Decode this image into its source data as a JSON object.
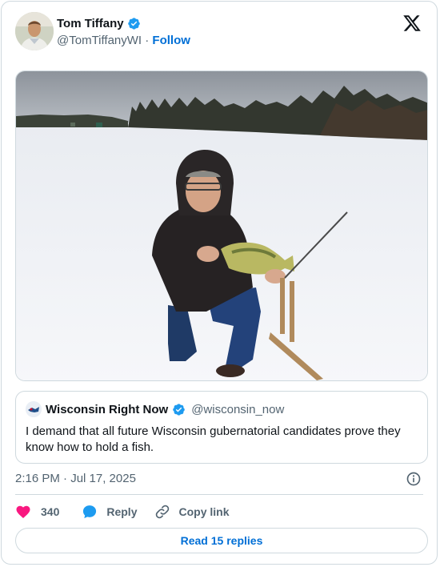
{
  "author": {
    "name": "Tom Tiffany",
    "handle": "@TomTiffanyWI",
    "separator": "·",
    "follow_label": "Follow"
  },
  "brand": {
    "logo_icon": "x-logo-icon"
  },
  "media": {
    "alt": "Man in a hooded jacket kneeling on a frozen snowy lake holding a fish next to an ice fishing rod"
  },
  "quote": {
    "name": "Wisconsin Right Now",
    "handle": "@wisconsin_now",
    "text": "I demand that all future Wisconsin gubernatorial candidates prove they know how to hold a fish."
  },
  "meta": {
    "timestamp": "2:16 PM · Jul 17, 2025"
  },
  "actions": {
    "like_count": "340",
    "reply_label": "Reply",
    "copy_label": "Copy link"
  },
  "footer": {
    "read_replies_label": "Read 15 replies"
  },
  "colors": {
    "accent": "#1d9bf0",
    "link": "#006fd6",
    "like": "#f91880",
    "muted": "#536471"
  }
}
